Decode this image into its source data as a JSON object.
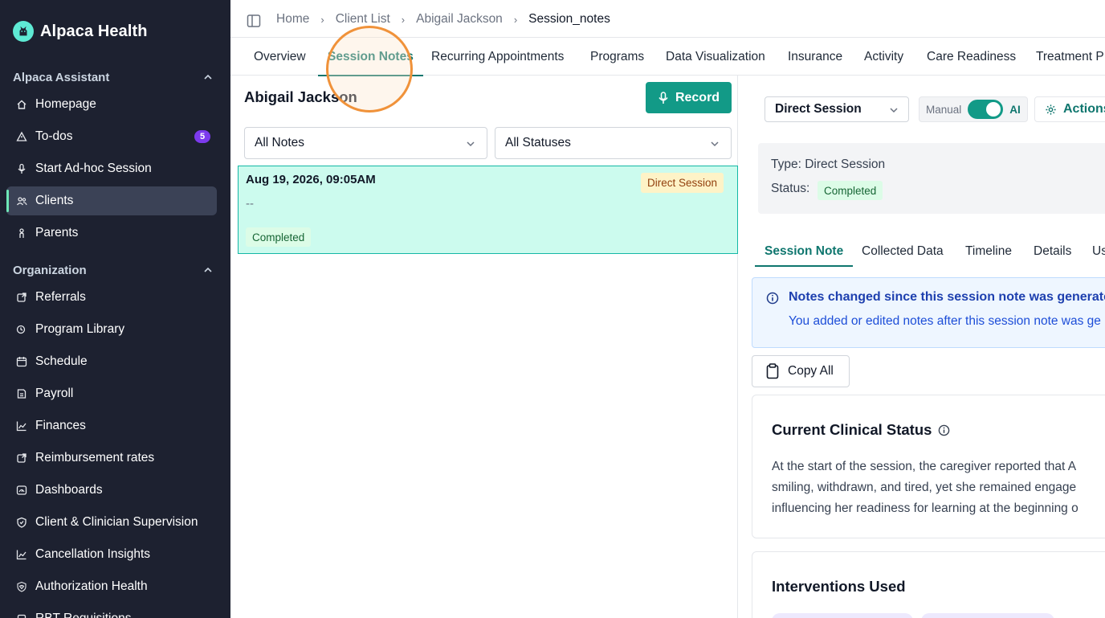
{
  "brand": {
    "name": "Alpaca Health"
  },
  "sidebar": {
    "sections": [
      {
        "label": "Alpaca Assistant"
      },
      {
        "label": "Organization"
      }
    ],
    "items": [
      {
        "label": "Homepage",
        "icon": "home-icon"
      },
      {
        "label": "To-dos",
        "icon": "alert-triangle-icon",
        "badge": "5"
      },
      {
        "label": "Start Ad-hoc Session",
        "icon": "microphone-icon"
      },
      {
        "label": "Clients",
        "icon": "users-icon",
        "active": true
      },
      {
        "label": "Parents",
        "icon": "baby-icon"
      },
      {
        "label": "Referrals",
        "icon": "referral-icon"
      },
      {
        "label": "Program Library",
        "icon": "library-icon"
      },
      {
        "label": "Schedule",
        "icon": "calendar-icon"
      },
      {
        "label": "Payroll",
        "icon": "payroll-icon"
      },
      {
        "label": "Finances",
        "icon": "chart-line-icon"
      },
      {
        "label": "Reimbursement rates",
        "icon": "reimbursement-icon"
      },
      {
        "label": "Dashboards",
        "icon": "gauge-icon"
      },
      {
        "label": "Client & Clinician Supervision",
        "icon": "shield-icon"
      },
      {
        "label": "Cancellation Insights",
        "icon": "trend-icon"
      },
      {
        "label": "Authorization Health",
        "icon": "heart-shield-icon"
      },
      {
        "label": "RBT Requisitions",
        "icon": "clipboard-icon"
      }
    ]
  },
  "breadcrumb": {
    "items": [
      "Home",
      "Client List",
      "Abigail Jackson",
      "Session_notes"
    ]
  },
  "tabs": [
    "Overview",
    "Session Notes",
    "Recurring Appointments",
    "Programs",
    "Data Visualization",
    "Insurance",
    "Activity",
    "Care Readiness",
    "Treatment P"
  ],
  "left": {
    "client_name": "Abigail Jackson",
    "record_label": "Record",
    "filter_notes": "All Notes",
    "filter_statuses": "All Statuses",
    "note": {
      "date": "Aug 19, 2026, 09:05AM",
      "summary": "--",
      "type": "Direct Session",
      "status": "Completed"
    }
  },
  "right": {
    "session_type_select": "Direct Session",
    "mode_manual": "Manual",
    "mode_ai": "AI",
    "mode_ai_enabled": true,
    "actions_label": "Actions",
    "info": {
      "type_text": "Type: Direct Session",
      "status_label": "Status:",
      "status_value": "Completed"
    },
    "subtabs": [
      "Session Note",
      "Collected Data",
      "Timeline",
      "Details",
      "Us"
    ],
    "alert": {
      "title": "Notes changed since this session note was generated",
      "text": "You added or edited notes after this session note was ge"
    },
    "copy_all_label": "Copy All",
    "clinical_status": {
      "title": "Current Clinical Status",
      "lines": [
        "At the start of the session, the caregiver reported that A",
        "smiling, withdrawn, and tired, yet she remained engage",
        "influencing her readiness for learning at the beginning o"
      ]
    },
    "interventions": {
      "title": "Interventions Used"
    }
  },
  "colors": {
    "sidebar_bg": "#1d2130",
    "accent": "#129a87",
    "active_note_bg": "#ccfbee",
    "highlight_ring": "#f0923a"
  }
}
